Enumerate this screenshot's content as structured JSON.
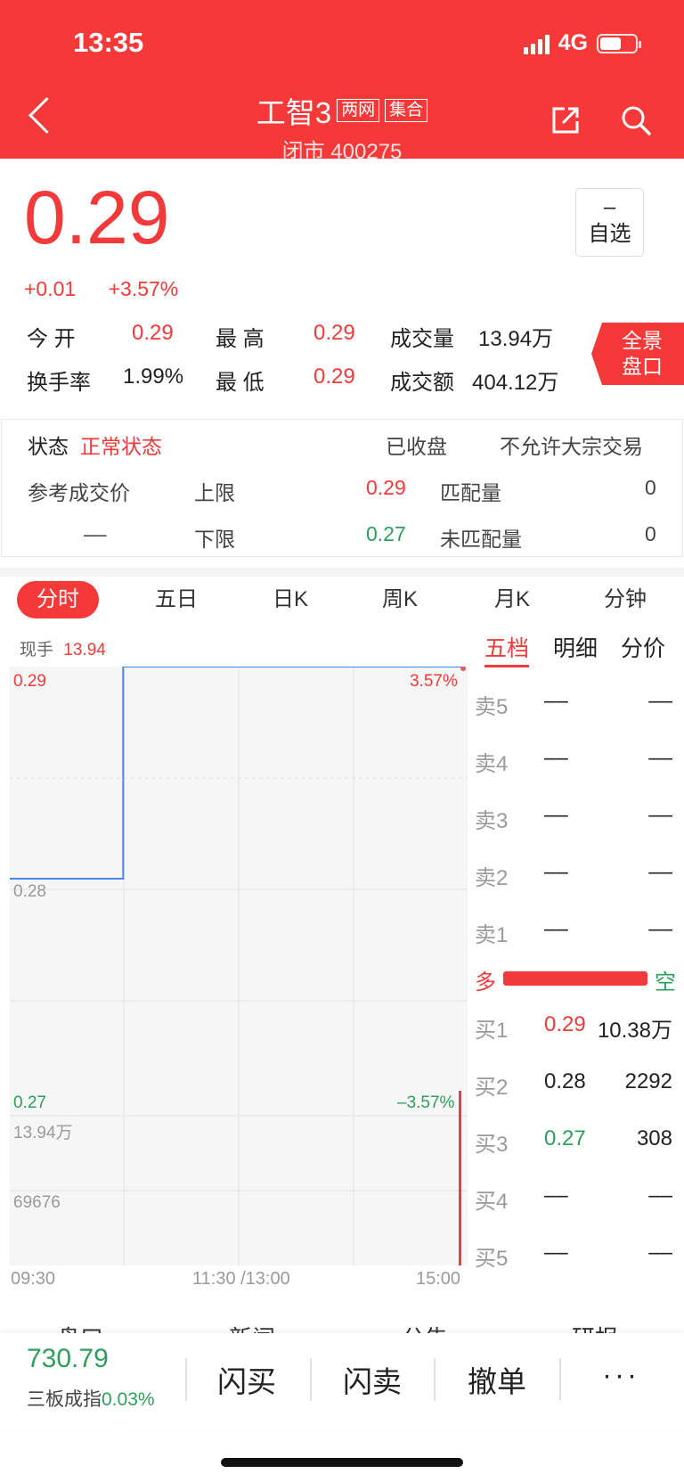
{
  "status_bar": {
    "time": "13:35",
    "network": "4G"
  },
  "header": {
    "stock_name": "工智3",
    "tags": [
      "两网",
      "集合"
    ],
    "subtitle": "闭市 400275"
  },
  "quote": {
    "price": "0.29",
    "change": "+0.01",
    "change_pct": "+3.57%",
    "watch_minus": "–",
    "watch_label": "自选",
    "panorama_label_1": "全景",
    "panorama_label_2": "盘口",
    "open_label": "今  开",
    "open_value": "0.29",
    "high_label": "最  高",
    "high_value": "0.29",
    "volume_label": "成交量",
    "volume_value": "13.94万",
    "turnover_label": "换手率",
    "turnover_value": "1.99%",
    "low_label": "最  低",
    "low_value": "0.29",
    "amount_label": "成交额",
    "amount_value": "404.12万"
  },
  "trade_status": {
    "status_label": "状态",
    "status_value": "正常状态",
    "closed_label": "已收盘",
    "block_label": "不允许大宗交易",
    "ref_price_label": "参考成交价",
    "ref_price_value": "––",
    "upper_label": "上限",
    "upper_value": "0.29",
    "lower_label": "下限",
    "lower_value": "0.27",
    "matched_label": "匹配量",
    "matched_value": "0",
    "unmatched_label": "未匹配量",
    "unmatched_value": "0"
  },
  "chart_tabs": [
    "分时",
    "五日",
    "日K",
    "周K",
    "月K",
    "分钟"
  ],
  "chart_info": {
    "current_hand_label": "现手",
    "current_hand_value": "13.94"
  },
  "chart_data": {
    "type": "line",
    "price_max_label": "0.29",
    "price_mid_label": "0.28",
    "price_min_label": "0.27",
    "pct_max_label": "3.57%",
    "pct_min_label": "–3.57%",
    "volume_max_label": "13.94万",
    "volume_mid_label": "69676",
    "ylim": [
      0.27,
      0.29
    ],
    "x_ticks": [
      "09:30",
      "11:30 /13:00",
      "15:00"
    ],
    "price_series": [
      {
        "t": 0.0,
        "price": 0.28
      },
      {
        "t": 0.25,
        "price": 0.28
      },
      {
        "t": 0.25,
        "price": 0.29
      },
      {
        "t": 1.0,
        "price": 0.29
      }
    ],
    "volume_bars": [
      {
        "t": 1.0,
        "volume": 139400
      }
    ],
    "volume_max": 139400
  },
  "depth_tabs": [
    "五档",
    "明细",
    "分价"
  ],
  "order_book": {
    "asks": [
      {
        "level": "卖5",
        "price": "––",
        "volume": "––"
      },
      {
        "level": "卖4",
        "price": "––",
        "volume": "––"
      },
      {
        "level": "卖3",
        "price": "––",
        "volume": "––"
      },
      {
        "level": "卖2",
        "price": "––",
        "volume": "––"
      },
      {
        "level": "卖1",
        "price": "––",
        "volume": "––"
      }
    ],
    "long_label": "多",
    "short_label": "空",
    "long_ratio": 1.0,
    "bids": [
      {
        "level": "买1",
        "price": "0.29",
        "volume": "10.38万"
      },
      {
        "level": "买2",
        "price": "0.28",
        "volume": "2292"
      },
      {
        "level": "买3",
        "price": "0.27",
        "volume": "308"
      },
      {
        "level": "买4",
        "price": "––",
        "volume": "––"
      },
      {
        "level": "买5",
        "price": "––",
        "volume": "––"
      }
    ]
  },
  "bottom_tabs": [
    "盘口",
    "新闻",
    "公告",
    "研报"
  ],
  "bottom_bar": {
    "index_value": "730.79",
    "index_name": "三板成指",
    "index_change": "0.03%",
    "buy_label": "闪买",
    "sell_label": "闪卖",
    "cancel_label": "撤单",
    "more_label": "···"
  },
  "colors": {
    "accent": "#f53838",
    "up": "#f23a3a",
    "down": "#2f9e5c",
    "line": "#4a86e8"
  }
}
